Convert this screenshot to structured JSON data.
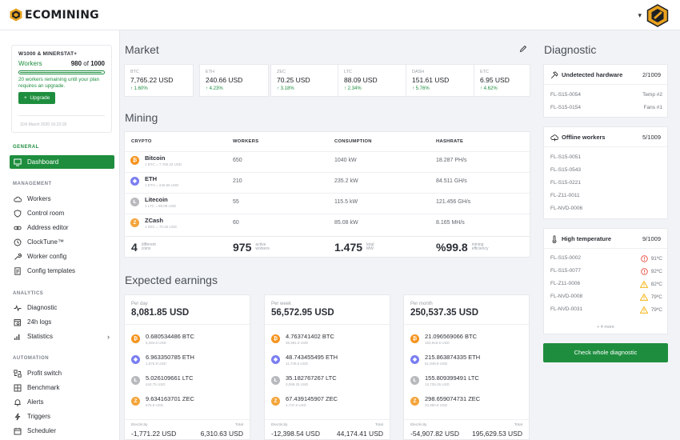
{
  "app": {
    "logo_text": "ECOMINING"
  },
  "colors": {
    "brand_green": "#1e8e3e",
    "btc": "#f5941e",
    "eth": "#7b7ff0",
    "ltc": "#b7b9bd",
    "zec": "#f3a43a",
    "warn": "#f3b71c",
    "error": "#e84c3d"
  },
  "plan": {
    "title": "W1000 & MINERSTAT+",
    "workers_label": "Workers",
    "used": "980",
    "of_label": "of",
    "total": "1000",
    "progress_fraction": 0.98,
    "note": "20 workers remaining until your plan requires an upgrade.",
    "upgrade_label": "Upgrade",
    "date": "11th March 2020 16:23:18"
  },
  "sidebar": {
    "general_label": "GENERAL",
    "dashboard": "Dashboard",
    "management_label": "MANAGEMENT",
    "management": [
      {
        "label": "Workers",
        "icon": "cloud-icon"
      },
      {
        "label": "Control room",
        "icon": "shield-icon"
      },
      {
        "label": "Address editor",
        "icon": "link-icon"
      },
      {
        "label": "ClockTune™",
        "icon": "clock-icon"
      },
      {
        "label": "Worker config",
        "icon": "wrench-icon"
      },
      {
        "label": "Config templates",
        "icon": "document-icon"
      }
    ],
    "analytics_label": "ANALYTICS",
    "analytics": [
      {
        "label": "Diagnostic",
        "icon": "pulse-icon"
      },
      {
        "label": "24h logs",
        "icon": "log-icon"
      },
      {
        "label": "Statistics",
        "icon": "bars-icon"
      }
    ],
    "automation_label": "AUTOMATION",
    "automation": [
      {
        "label": "Profit switch",
        "icon": "switch-icon"
      },
      {
        "label": "Benchmark",
        "icon": "grid-icon"
      },
      {
        "label": "Alerts",
        "icon": "bell-icon"
      },
      {
        "label": "Triggers",
        "icon": "trigger-icon"
      },
      {
        "label": "Scheduler",
        "icon": "calendar-icon"
      }
    ]
  },
  "market": {
    "title": "Market",
    "tickers": [
      {
        "symbol": "BTC",
        "price": "7,765.22 USD",
        "change": "↑ 1.60%"
      },
      {
        "symbol": "ETH",
        "price": "240.66 USD",
        "change": "↑ 4.23%"
      },
      {
        "symbol": "ZEC",
        "price": "70.25 USD",
        "change": "↑ 3.18%"
      },
      {
        "symbol": "LTC",
        "price": "88.09 USD",
        "change": "↑ 2.34%"
      },
      {
        "symbol": "DASH",
        "price": "151.61 USD",
        "change": "↑ 5.76%"
      },
      {
        "symbol": "ETC",
        "price": "6.95 USD",
        "change": "↑ 4.62%"
      }
    ]
  },
  "mining": {
    "title": "Mining",
    "headers": {
      "crypto": "CRYPTO",
      "workers": "WORKERS",
      "consumption": "CONSUMPTION",
      "hashrate": "HASHRATE"
    },
    "rows": [
      {
        "coin_glyph": "₿",
        "name": "Bitcoin",
        "sub": "1 BTC = 7,765.22 USD",
        "workers": "650",
        "consumption": "1040 kW",
        "hashrate": "18.287 PH/s"
      },
      {
        "coin_glyph": "◆",
        "name": "ETH",
        "sub": "1 ETH = 240.66 USD",
        "workers": "210",
        "consumption": "235.2 kW",
        "hashrate": "84.511 GH/s"
      },
      {
        "coin_glyph": "Ł",
        "name": "Litecoin",
        "sub": "1 LTC = 88.09 USD",
        "workers": "55",
        "consumption": "115.5 kW",
        "hashrate": "121.456 GH/s"
      },
      {
        "coin_glyph": "Z",
        "name": "ZCash",
        "sub": "1 ZEC = 70.25 USD",
        "workers": "60",
        "consumption": "85.08 kW",
        "hashrate": "8.165 MH/s"
      }
    ],
    "summary": [
      {
        "value": "4",
        "label": "different coins"
      },
      {
        "value": "975",
        "label": "active workers"
      },
      {
        "value": "1.475",
        "label": "total MW"
      },
      {
        "value": "%99.8",
        "label": "mining efficiency"
      }
    ]
  },
  "earnings": {
    "title": "Expected earnings",
    "cards": [
      {
        "period": "Per day",
        "total": "8,081.85 USD",
        "rows": [
          {
            "value": "0.680534486 BTC",
            "sub": "5,284.5 USD"
          },
          {
            "value": "6.963350785 ETH",
            "sub": "1,675.8 USD"
          },
          {
            "value": "5.026109661 LTC",
            "sub": "442.75 USD"
          },
          {
            "value": "9.634163701 ZEC",
            "sub": "676.8 USD"
          }
        ],
        "electricity_label": "Electricity",
        "electricity": "-1,771.22 USD",
        "total_label": "Total",
        "net": "6,310.63 USD"
      },
      {
        "period": "Per week",
        "total": "56,572.95 USD",
        "rows": [
          {
            "value": "4.763741402 BTC",
            "sub": "36,991.5 USD"
          },
          {
            "value": "48.743455495 ETH",
            "sub": "11,730.6 USD"
          },
          {
            "value": "35.182767267 LTC",
            "sub": "3,099.25 USD"
          },
          {
            "value": "67.439145907 ZEC",
            "sub": "4,737.6 USD"
          }
        ],
        "electricity_label": "Electricity",
        "electricity": "-12,398.54 USD",
        "total_label": "Total",
        "net": "44,174.41 USD"
      },
      {
        "period": "Per month",
        "total": "250,537.35 USD",
        "rows": [
          {
            "value": "21.096569066 BTC",
            "sub": "163,819.5 USD"
          },
          {
            "value": "215.863874335 ETH",
            "sub": "51,949.8 USD"
          },
          {
            "value": "155.809399491 LTC",
            "sub": "13,725.25 USD"
          },
          {
            "value": "298.659074731 ZEC",
            "sub": "20,980.8 USD"
          }
        ],
        "electricity_label": "Electricity",
        "electricity": "-54,907.82 USD",
        "total_label": "Total",
        "net": "195,629.53 USD"
      }
    ]
  },
  "diagnostic": {
    "title": "Diagnostic",
    "hardware": {
      "title": "Undetected hardware",
      "count": "2/1009",
      "rows": [
        {
          "id": "FL-S15-0054",
          "detail": "Temp #2"
        },
        {
          "id": "FL-S15-0154",
          "detail": "Fans #1"
        }
      ]
    },
    "offline": {
      "title": "Offline workers",
      "count": "5/1009",
      "rows": [
        "FL-S15-0051",
        "FL-S15-0543",
        "FL-S15-0221",
        "FL-Z11-0011",
        "FL-NVD-0006"
      ]
    },
    "temperature": {
      "title": "High temperature",
      "count": "9/1009",
      "rows": [
        {
          "id": "FL-S15-0002",
          "temp": "91ºC",
          "level": "error"
        },
        {
          "id": "FL-S15-0077",
          "temp": "92ºC",
          "level": "error"
        },
        {
          "id": "FL-Z11-0006",
          "temp": "82ºC",
          "level": "warn"
        },
        {
          "id": "FL-NVD-0008",
          "temp": "79ºC",
          "level": "warn"
        },
        {
          "id": "FL-NVD-0031",
          "temp": "79ºC",
          "level": "warn"
        }
      ],
      "more": "+ 4 more"
    },
    "check_button": "Check whole diagnostic"
  }
}
